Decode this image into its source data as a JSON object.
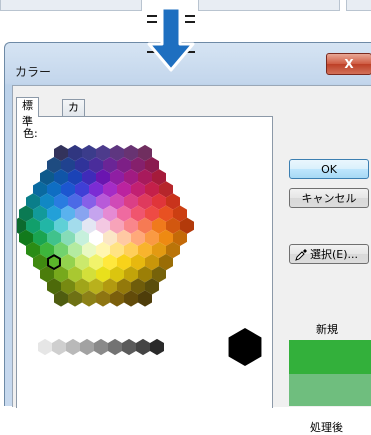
{
  "dialog": {
    "title": "カラー",
    "close_label": "X",
    "tabs": [
      {
        "label": "標準",
        "active": true
      },
      {
        "label": "カスタム",
        "active": false
      }
    ],
    "colors_label": "色:",
    "buttons": {
      "ok": "OK",
      "cancel": "キャンセル",
      "select": "選択(E)..."
    },
    "new_label": "新規",
    "current_label": "処理後",
    "new_color": "#33b03b",
    "current_color": "#6fbe7e"
  },
  "hex_rows": [
    [
      "#33335c",
      "#303680",
      "#3b3c8b",
      "#4d3b8c",
      "#5e3680",
      "#683372",
      "#702e5f"
    ],
    [
      "#1e4b80",
      "#20428f",
      "#30339a",
      "#4a2d9b",
      "#6a2596",
      "#7d1f86",
      "#85206c",
      "#8a1b50"
    ],
    [
      "#0d5a8c",
      "#1055a8",
      "#1b43b7",
      "#3f2bb9",
      "#6a15b0",
      "#8f1ea3",
      "#a11b82",
      "#a81a5c",
      "#a51b3b"
    ],
    [
      "#0a6aa0",
      "#0f6ec3",
      "#1c56d0",
      "#3f3fd6",
      "#7b2cd4",
      "#a52cc6",
      "#bb239f",
      "#c22072",
      "#c4204a",
      "#b6262b"
    ],
    [
      "#0a7e8a",
      "#1188c4",
      "#2a7ce0",
      "#4c6ae6",
      "#8660e8",
      "#b85ad9",
      "#d04ab7",
      "#db3f86",
      "#df3a5d",
      "#e0353a",
      "#c9331c"
    ],
    [
      "#0b7a53",
      "#129a9a",
      "#23a0d8",
      "#5ab2ee",
      "#88a4f0",
      "#c5a4ee",
      "#e58ad3",
      "#ef6aa0",
      "#f0556e",
      "#ee4a44",
      "#e85122",
      "#cc3f12"
    ],
    [
      "#0c6a2e",
      "#119f6b",
      "#22b6a6",
      "#5fd0d6",
      "#a3dcec",
      "#e3e6f3",
      "#f3c8e2",
      "#f7a3b9",
      "#f9868b",
      "#f67a54",
      "#f07a1c",
      "#d2570f",
      "#b33a0b"
    ],
    [
      "#127a1c",
      "#1aa450",
      "#40c28c",
      "#86dcb8",
      "#c6f0dc",
      "#ffffff",
      "#fbe6c6",
      "#ffc9a3",
      "#ffa97a",
      "#fa9a43",
      "#ee8a12",
      "#c46a08"
    ],
    [
      "#2a8c15",
      "#3db53c",
      "#72d26d",
      "#b4eba0",
      "#e9f9c2",
      "#fff6b0",
      "#ffe383",
      "#ffcf5a",
      "#f8b42d",
      "#e39a12",
      "#ba7408"
    ],
    [
      "#3f8a10",
      "#5ab52a",
      "#93d24e",
      "#cbe96c",
      "#f1f36b",
      "#ffe83d",
      "#f8d21a",
      "#e7b80f",
      "#c9960a",
      "#9a6d06"
    ],
    [
      "#4b7d0b",
      "#76a91c",
      "#a9c831",
      "#d3df3a",
      "#e9e01c",
      "#dbc50f",
      "#c2a40a",
      "#9c7f07",
      "#76620a"
    ],
    [
      "#4d6a0a",
      "#778a12",
      "#a0a51a",
      "#b9b11c",
      "#b29a10",
      "#93790b",
      "#6f5d0b",
      "#5a4e0c"
    ],
    [
      "#4f5d10",
      "#6e7114",
      "#8c8117",
      "#8e7512",
      "#7b5f0c",
      "#624b0a",
      "#4e3d0a"
    ]
  ],
  "gray_row": [
    "#ffffff",
    "#e6e6e6",
    "#cfcfcf",
    "#b9b9b9",
    "#a2a2a2",
    "#8a8a8a",
    "#737373",
    "#5b5b5b",
    "#444444",
    "#2a2a2a"
  ],
  "big_black": "#000000",
  "selected": {
    "row": 9,
    "col": 1
  }
}
